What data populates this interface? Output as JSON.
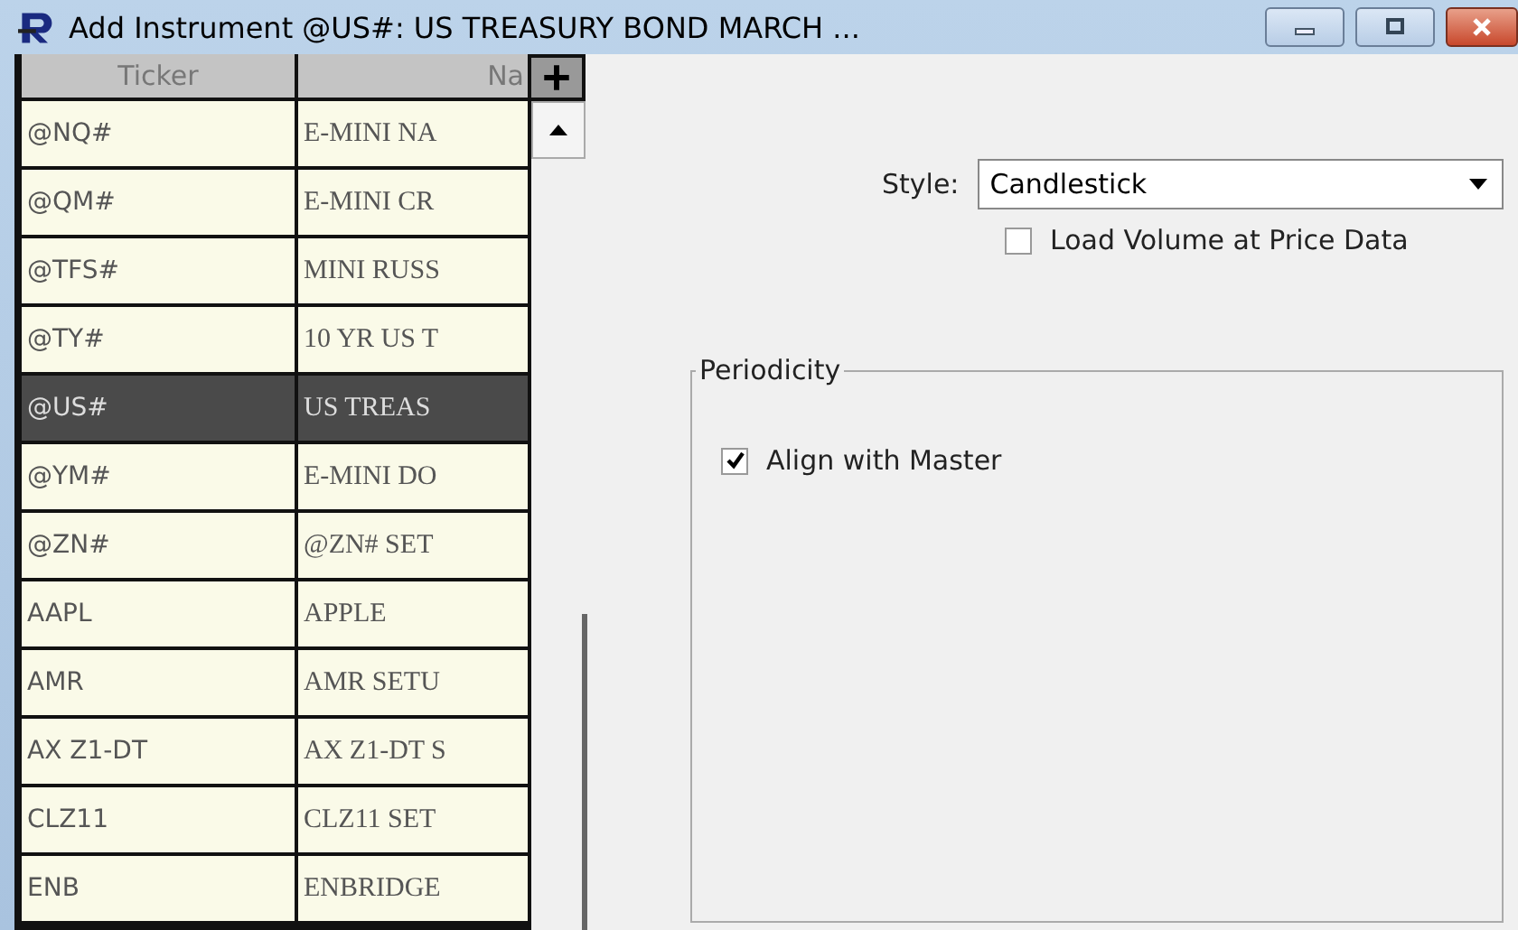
{
  "window": {
    "title": "Add Instrument @US#: US TREASURY BOND MARCH ..."
  },
  "table": {
    "columns": [
      "Ticker",
      "Na"
    ],
    "rows": [
      {
        "ticker": "@NQ#",
        "name": "E-MINI NA",
        "selected": false
      },
      {
        "ticker": "@QM#",
        "name": "E-MINI CR",
        "selected": false
      },
      {
        "ticker": "@TFS#",
        "name": "MINI RUSS",
        "selected": false
      },
      {
        "ticker": "@TY#",
        "name": "10 YR US T",
        "selected": false
      },
      {
        "ticker": "@US#",
        "name": "US TREAS",
        "selected": true
      },
      {
        "ticker": "@YM#",
        "name": "E-MINI DO",
        "selected": false
      },
      {
        "ticker": "@ZN#",
        "name": "@ZN# SET",
        "selected": false
      },
      {
        "ticker": "AAPL",
        "name": "APPLE",
        "selected": false
      },
      {
        "ticker": "AMR",
        "name": "AMR SETU",
        "selected": false
      },
      {
        "ticker": "AX Z1-DT",
        "name": "AX Z1-DT S",
        "selected": false
      },
      {
        "ticker": "CLZ11",
        "name": "CLZ11 SET",
        "selected": false
      },
      {
        "ticker": "ENB",
        "name": "ENBRIDGE",
        "selected": false
      }
    ]
  },
  "style": {
    "label": "Style:",
    "value": "Candlestick"
  },
  "load_volume": {
    "label": "Load Volume at Price Data",
    "checked": false
  },
  "periodicity": {
    "title": "Periodicity",
    "align_with_master": {
      "label": "Align with Master",
      "checked": true
    }
  }
}
